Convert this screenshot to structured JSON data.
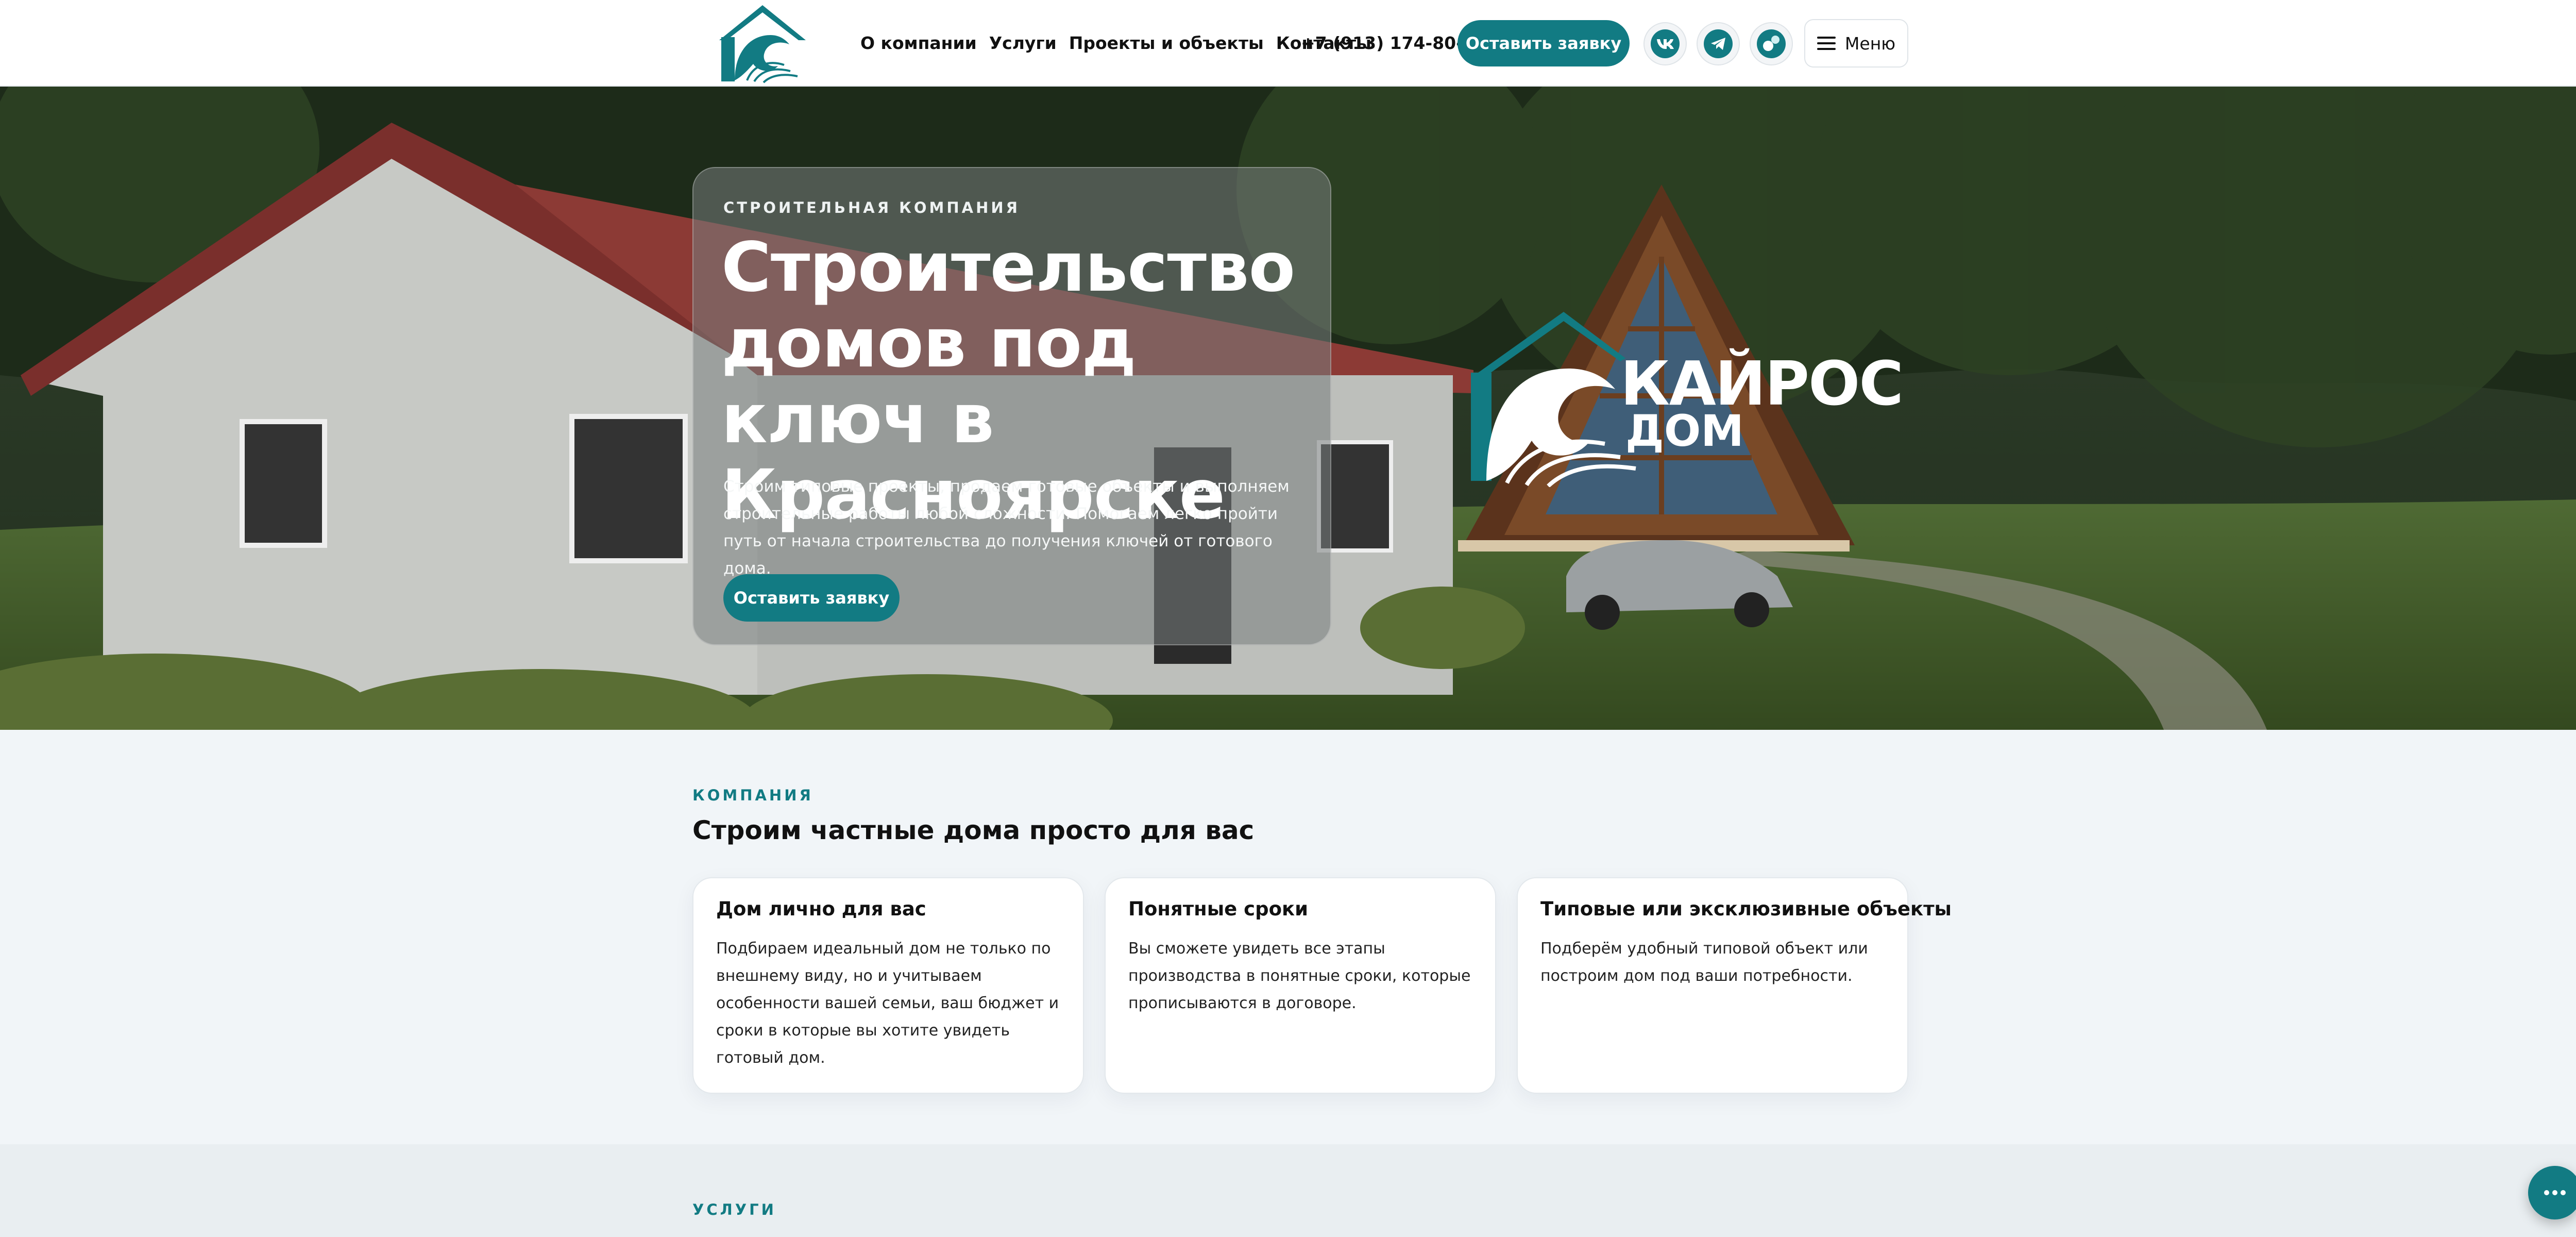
{
  "header": {
    "nav": [
      "О компании",
      "Услуги",
      "Проекты и объекты",
      "Контакты"
    ],
    "phone": "+7 (913) 174-80-26",
    "cta_label": "Оставить заявку",
    "social_icons": [
      "vk-icon",
      "telegram-icon",
      "max-messenger-icon"
    ],
    "menu_label": "Меню"
  },
  "hero": {
    "eyebrow": "СТРОИТЕЛЬНАЯ КОМПАНИЯ",
    "title": "Строительство домов под ключ в Красноярске",
    "description": "Строим типовые проекты, продаем готовые объекты и выполняем строительные работы любой сложности. Помогаем легко пройти путь от начала строительства до получения ключей от готового дома.",
    "cta_label": "Оставить заявку",
    "brand": {
      "line1": "КАЙРОС",
      "line2": "ДОМ"
    }
  },
  "company": {
    "eyebrow": "КОМПАНИЯ",
    "title": "Строим частные дома просто для вас",
    "cards": [
      {
        "title": "Дом лично для вас",
        "text": "Подбираем идеальный дом не только по внешнему виду, но и учитываем особенности вашей семьи, ваш бюджет и сроки в которые вы хотите увидеть готовый дом."
      },
      {
        "title": "Понятные сроки",
        "text": "Вы сможете увидеть все этапы производства в понятные сроки, которые прописываются в договоре."
      },
      {
        "title": "Типовые или эксклюзивные объекты",
        "text": "Подберём удобный типовой объект или построим дом под ваши потребности."
      }
    ]
  },
  "services": {
    "eyebrow": "УСЛУГИ"
  },
  "colors": {
    "accent": "#127b83",
    "page_bg": "#f1f5f8",
    "card_bg": "#ffffff"
  }
}
